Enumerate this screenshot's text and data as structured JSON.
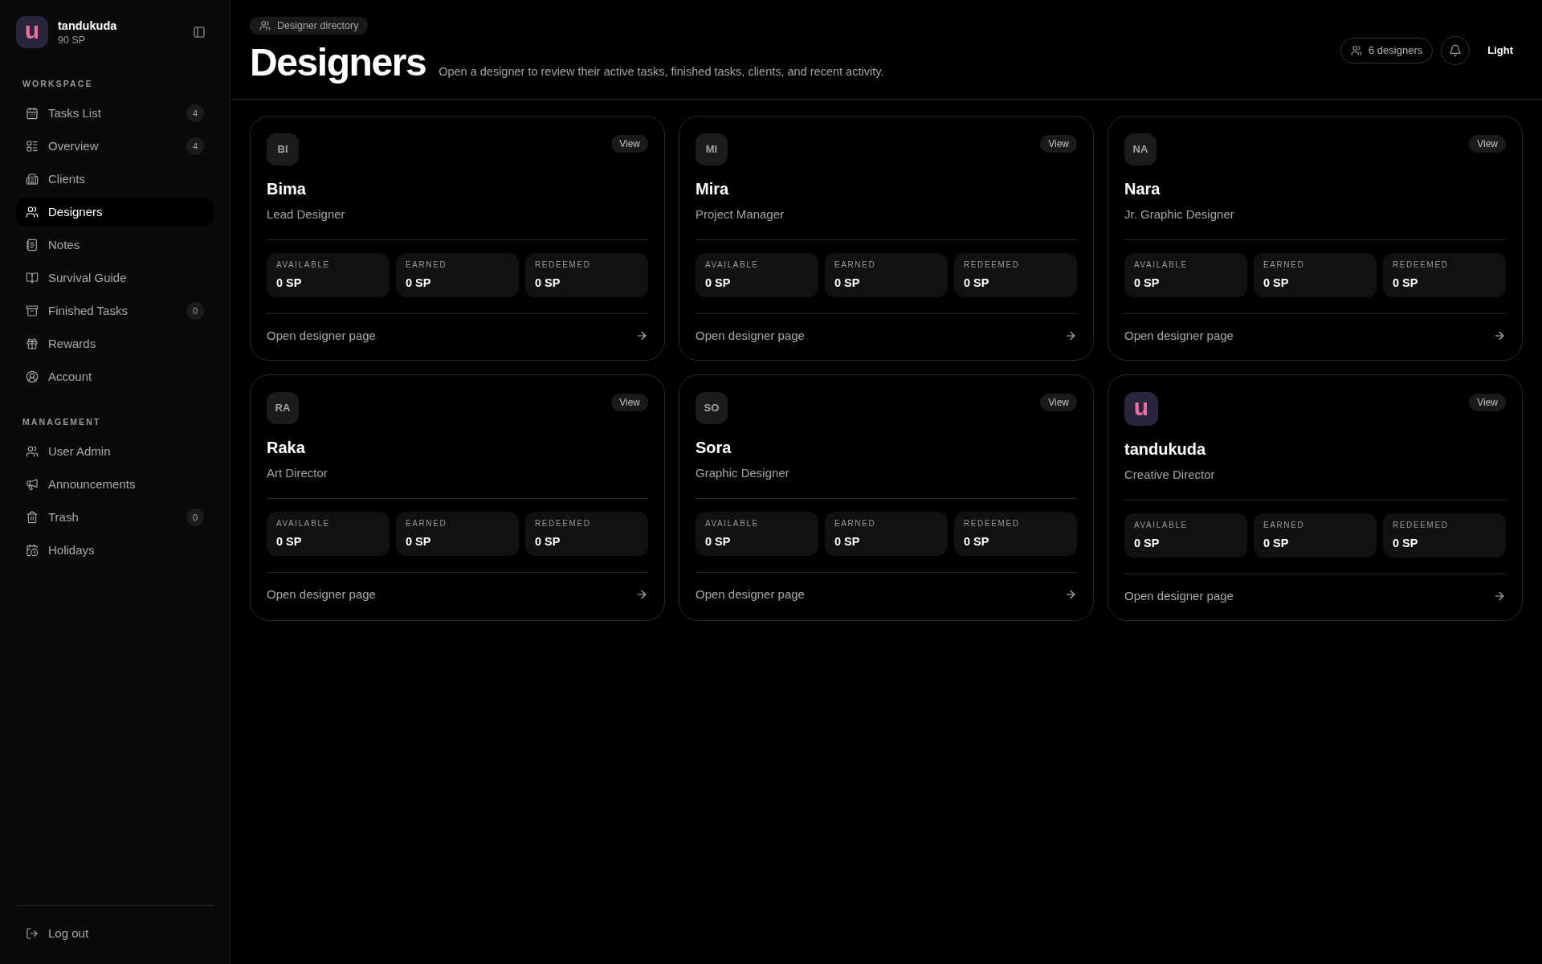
{
  "sidebar": {
    "user": {
      "avatar": {
        "kind": "logo",
        "text": "u"
      },
      "name": "tandukuda",
      "points": "90 SP"
    },
    "sections": [
      {
        "title": "WORKSPACE",
        "items": [
          {
            "label": "Tasks List",
            "badge": "4",
            "selected": false
          },
          {
            "label": "Overview",
            "badge": "4",
            "selected": false
          },
          {
            "label": "Clients",
            "selected": false
          },
          {
            "label": "Designers",
            "selected": true
          },
          {
            "label": "Notes",
            "selected": false
          },
          {
            "label": "Survival Guide",
            "selected": false
          },
          {
            "label": "Finished Tasks",
            "badge": "0",
            "selected": false
          },
          {
            "label": "Rewards",
            "selected": false
          },
          {
            "label": "Account",
            "selected": false
          }
        ]
      },
      {
        "title": "MANAGEMENT",
        "items": [
          {
            "label": "User Admin",
            "selected": false
          },
          {
            "label": "Announcements",
            "selected": false
          },
          {
            "label": "Trash",
            "badge": "0",
            "selected": false
          },
          {
            "label": "Holidays",
            "selected": false
          }
        ]
      }
    ],
    "logout": "Log out"
  },
  "header": {
    "breadcrumb": "Designer directory",
    "title": "Designers",
    "subtitle": "Open a designer to review their active tasks, finished tasks, clients, and recent activity.",
    "count": "6 designers",
    "theme_toggle": "Light"
  },
  "designers": [
    {
      "avatar": {
        "kind": "initials",
        "text": "BI"
      },
      "name": "Bima",
      "role": "Lead Designer",
      "action": "View",
      "stats": [
        {
          "label": "AVAILABLE",
          "value": "0 SP"
        },
        {
          "label": "EARNED",
          "value": "0 SP"
        },
        {
          "label": "REDEEMED",
          "value": "0 SP"
        }
      ],
      "link": "Open designer page"
    },
    {
      "avatar": {
        "kind": "initials",
        "text": "MI"
      },
      "name": "Mira",
      "role": "Project Manager",
      "action": "View",
      "stats": [
        {
          "label": "AVAILABLE",
          "value": "0 SP"
        },
        {
          "label": "EARNED",
          "value": "0 SP"
        },
        {
          "label": "REDEEMED",
          "value": "0 SP"
        }
      ],
      "link": "Open designer page"
    },
    {
      "avatar": {
        "kind": "initials",
        "text": "NA"
      },
      "name": "Nara",
      "role": "Jr. Graphic Designer",
      "action": "View",
      "stats": [
        {
          "label": "AVAILABLE",
          "value": "0 SP"
        },
        {
          "label": "EARNED",
          "value": "0 SP"
        },
        {
          "label": "REDEEMED",
          "value": "0 SP"
        }
      ],
      "link": "Open designer page"
    },
    {
      "avatar": {
        "kind": "initials",
        "text": "RA"
      },
      "name": "Raka",
      "role": "Art Director",
      "action": "View",
      "stats": [
        {
          "label": "AVAILABLE",
          "value": "0 SP"
        },
        {
          "label": "EARNED",
          "value": "0 SP"
        },
        {
          "label": "REDEEMED",
          "value": "0 SP"
        }
      ],
      "link": "Open designer page"
    },
    {
      "avatar": {
        "kind": "initials",
        "text": "SO"
      },
      "name": "Sora",
      "role": "Graphic Designer",
      "action": "View",
      "stats": [
        {
          "label": "AVAILABLE",
          "value": "0 SP"
        },
        {
          "label": "EARNED",
          "value": "0 SP"
        },
        {
          "label": "REDEEMED",
          "value": "0 SP"
        }
      ],
      "link": "Open designer page"
    },
    {
      "avatar": {
        "kind": "logo",
        "text": "u"
      },
      "name": "tandukuda",
      "role": "Creative Director",
      "action": "View",
      "stats": [
        {
          "label": "AVAILABLE",
          "value": "0 SP"
        },
        {
          "label": "EARNED",
          "value": "0 SP"
        },
        {
          "label": "REDEEMED",
          "value": "0 SP"
        }
      ],
      "link": "Open designer page"
    }
  ]
}
